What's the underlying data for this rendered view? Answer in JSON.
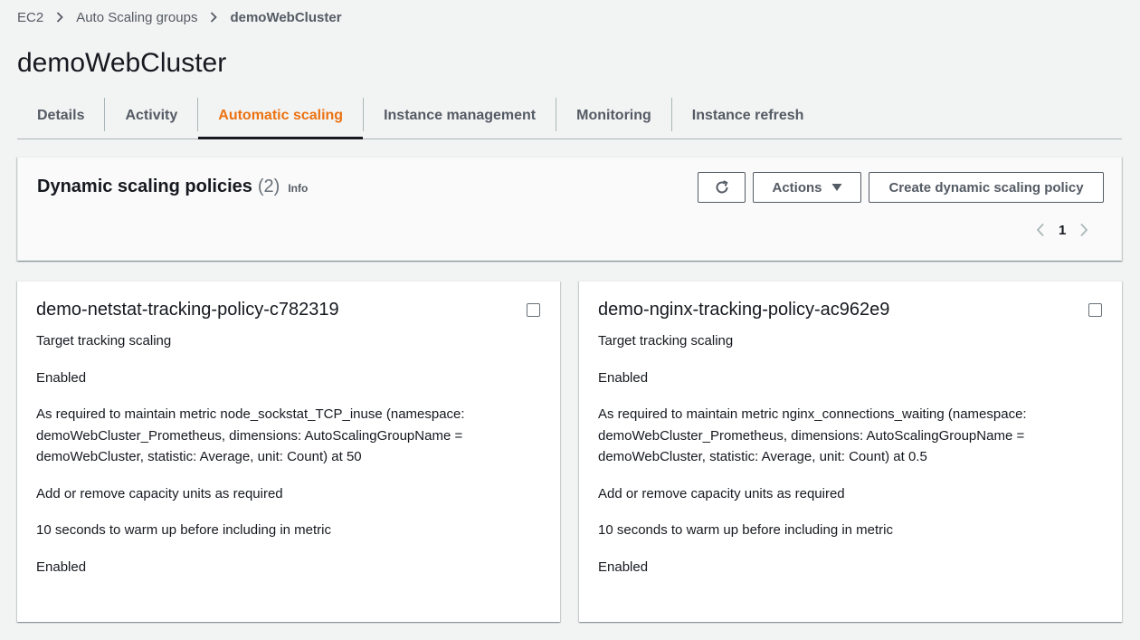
{
  "breadcrumb": {
    "items": [
      "EC2",
      "Auto Scaling groups"
    ],
    "current": "demoWebCluster"
  },
  "page_title": "demoWebCluster",
  "tabs": [
    {
      "label": "Details",
      "active": false
    },
    {
      "label": "Activity",
      "active": false
    },
    {
      "label": "Automatic scaling",
      "active": true
    },
    {
      "label": "Instance management",
      "active": false
    },
    {
      "label": "Monitoring",
      "active": false
    },
    {
      "label": "Instance refresh",
      "active": false
    }
  ],
  "policies": {
    "title": "Dynamic scaling policies",
    "count": "(2)",
    "info": "Info",
    "refresh_icon": "refresh-icon",
    "actions_label": "Actions",
    "create_label": "Create dynamic scaling policy",
    "page": "1"
  },
  "cards": [
    {
      "name": "demo-netstat-tracking-policy-c782319",
      "type": "Target tracking scaling",
      "status": "Enabled",
      "description": "As required to maintain metric node_sockstat_TCP_inuse (namespace: demoWebCluster_Prometheus, dimensions: AutoScalingGroupName = demoWebCluster, statistic: Average, unit: Count) at 50",
      "capacity": "Add or remove capacity units as required",
      "warmup": "10 seconds to warm up before including in metric",
      "scale_in": "Enabled"
    },
    {
      "name": "demo-nginx-tracking-policy-ac962e9",
      "type": "Target tracking scaling",
      "status": "Enabled",
      "description": "As required to maintain metric nginx_connections_waiting (namespace: demoWebCluster_Prometheus, dimensions: AutoScalingGroupName = demoWebCluster, statistic: Average, unit: Count) at 0.5",
      "capacity": "Add or remove capacity units as required",
      "warmup": "10 seconds to warm up before including in metric",
      "scale_in": "Enabled"
    }
  ],
  "colors": {
    "accent": "#ec7211",
    "text": "#16191f",
    "muted": "#545b64",
    "background": "#f2f3f3"
  }
}
